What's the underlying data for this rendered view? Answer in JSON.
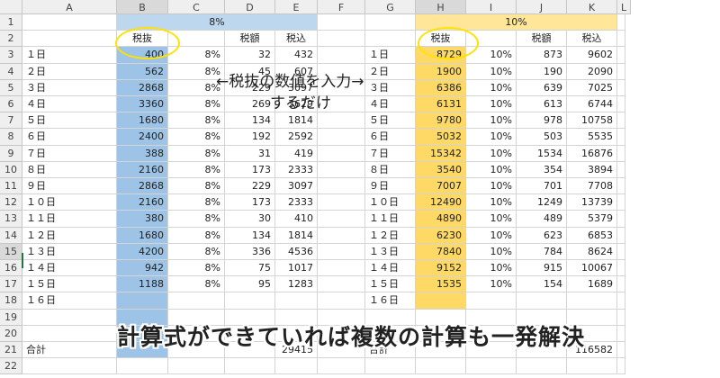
{
  "columns": [
    "A",
    "B",
    "C",
    "D",
    "E",
    "F",
    "G",
    "H",
    "I",
    "J",
    "K",
    "L"
  ],
  "rows": [
    "1",
    "2",
    "3",
    "4",
    "5",
    "6",
    "7",
    "8",
    "9",
    "10",
    "11",
    "12",
    "13",
    "14",
    "15",
    "16",
    "17",
    "18",
    "19",
    "20",
    "21",
    "22"
  ],
  "left_table": {
    "merged_header": "8%",
    "col_headers": {
      "zeinuki": "税抜",
      "zeigaku": "税額",
      "zeikomi": "税込"
    },
    "rows": [
      {
        "day": "１日",
        "base": "400",
        "rate": "8%",
        "tax": "32",
        "total": "432"
      },
      {
        "day": "２日",
        "base": "562",
        "rate": "8%",
        "tax": "45",
        "total": "607"
      },
      {
        "day": "３日",
        "base": "2868",
        "rate": "8%",
        "tax": "229",
        "total": "3097"
      },
      {
        "day": "４日",
        "base": "3360",
        "rate": "8%",
        "tax": "269",
        "total": "3629"
      },
      {
        "day": "５日",
        "base": "1680",
        "rate": "8%",
        "tax": "134",
        "total": "1814"
      },
      {
        "day": "６日",
        "base": "2400",
        "rate": "8%",
        "tax": "192",
        "total": "2592"
      },
      {
        "day": "７日",
        "base": "388",
        "rate": "8%",
        "tax": "31",
        "total": "419"
      },
      {
        "day": "８日",
        "base": "2160",
        "rate": "8%",
        "tax": "173",
        "total": "2333"
      },
      {
        "day": "９日",
        "base": "2868",
        "rate": "8%",
        "tax": "229",
        "total": "3097"
      },
      {
        "day": "１０日",
        "base": "2160",
        "rate": "8%",
        "tax": "173",
        "total": "2333"
      },
      {
        "day": "１１日",
        "base": "380",
        "rate": "8%",
        "tax": "30",
        "total": "410"
      },
      {
        "day": "１２日",
        "base": "1680",
        "rate": "8%",
        "tax": "134",
        "total": "1814"
      },
      {
        "day": "１３日",
        "base": "4200",
        "rate": "8%",
        "tax": "336",
        "total": "4536"
      },
      {
        "day": "１４日",
        "base": "942",
        "rate": "8%",
        "tax": "75",
        "total": "1017"
      },
      {
        "day": "１５日",
        "base": "1188",
        "rate": "8%",
        "tax": "95",
        "total": "1283"
      },
      {
        "day": "１６日",
        "base": "",
        "rate": "",
        "tax": "",
        "total": ""
      }
    ],
    "total_label": "合計",
    "total_value": "29415"
  },
  "right_table": {
    "merged_header": "10%",
    "col_headers": {
      "zeinuki": "税抜",
      "zeigaku": "税額",
      "zeikomi": "税込"
    },
    "rows": [
      {
        "day": "１日",
        "base": "8729",
        "rate": "10%",
        "tax": "873",
        "total": "9602"
      },
      {
        "day": "２日",
        "base": "1900",
        "rate": "10%",
        "tax": "190",
        "total": "2090"
      },
      {
        "day": "３日",
        "base": "6386",
        "rate": "10%",
        "tax": "639",
        "total": "7025"
      },
      {
        "day": "４日",
        "base": "6131",
        "rate": "10%",
        "tax": "613",
        "total": "6744"
      },
      {
        "day": "５日",
        "base": "9780",
        "rate": "10%",
        "tax": "978",
        "total": "10758"
      },
      {
        "day": "６日",
        "base": "5032",
        "rate": "10%",
        "tax": "503",
        "total": "5535"
      },
      {
        "day": "７日",
        "base": "15342",
        "rate": "10%",
        "tax": "1534",
        "total": "16876"
      },
      {
        "day": "８日",
        "base": "3540",
        "rate": "10%",
        "tax": "354",
        "total": "3894"
      },
      {
        "day": "９日",
        "base": "7007",
        "rate": "10%",
        "tax": "701",
        "total": "7708"
      },
      {
        "day": "１０日",
        "base": "12490",
        "rate": "10%",
        "tax": "1249",
        "total": "13739"
      },
      {
        "day": "１１日",
        "base": "4890",
        "rate": "10%",
        "tax": "489",
        "total": "5379"
      },
      {
        "day": "１２日",
        "base": "6230",
        "rate": "10%",
        "tax": "623",
        "total": "6853"
      },
      {
        "day": "１３日",
        "base": "7840",
        "rate": "10%",
        "tax": "784",
        "total": "8624"
      },
      {
        "day": "１４日",
        "base": "9152",
        "rate": "10%",
        "tax": "915",
        "total": "10067"
      },
      {
        "day": "１５日",
        "base": "1535",
        "rate": "10%",
        "tax": "154",
        "total": "1689"
      },
      {
        "day": "１６日",
        "base": "",
        "rate": "",
        "tax": "",
        "total": ""
      }
    ],
    "total_label": "合計",
    "total_value": "116582"
  },
  "annotations": {
    "arrow_text": "←税抜の数値を入力→",
    "arrow_text2": "するだけ",
    "bottom_text": "計算式ができていれば複数の計算も一発解決"
  },
  "colors": {
    "blue_column": "#9dc3e6",
    "blue_header": "#bdd7ee",
    "orange_column": "#ffd966",
    "orange_header": "#ffe699",
    "circle": "#ffe200"
  }
}
